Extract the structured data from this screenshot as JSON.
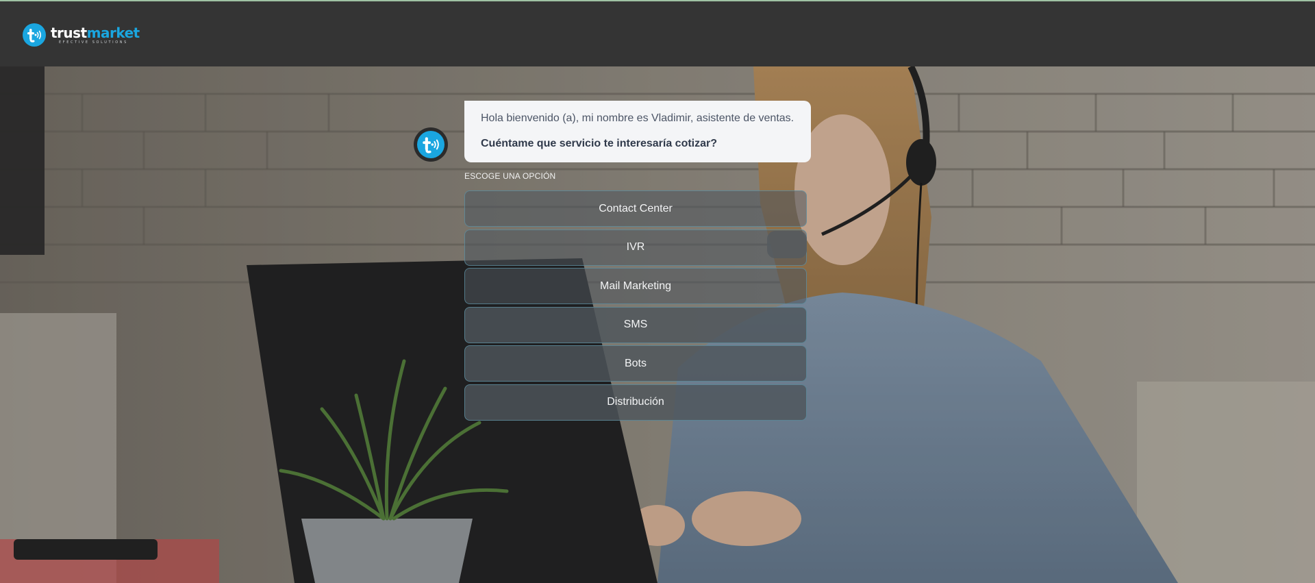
{
  "brand": {
    "word_main": "trust",
    "word_accent": "market",
    "tagline": "EFECTIVE SOLUTIONS",
    "accent_color": "#1aa6e0"
  },
  "chat": {
    "greeting": "Hola bienvenido (a), mi nombre es Vladimir, asistente de ventas.",
    "question": "Cuéntame que servicio te interesaría cotizar?",
    "choose_label": "ESCOGE UNA OPCIÓN",
    "options": [
      {
        "label": "Contact Center"
      },
      {
        "label": "IVR"
      },
      {
        "label": "Mail Marketing"
      },
      {
        "label": "SMS"
      },
      {
        "label": "Bots"
      },
      {
        "label": "Distribución"
      }
    ]
  }
}
